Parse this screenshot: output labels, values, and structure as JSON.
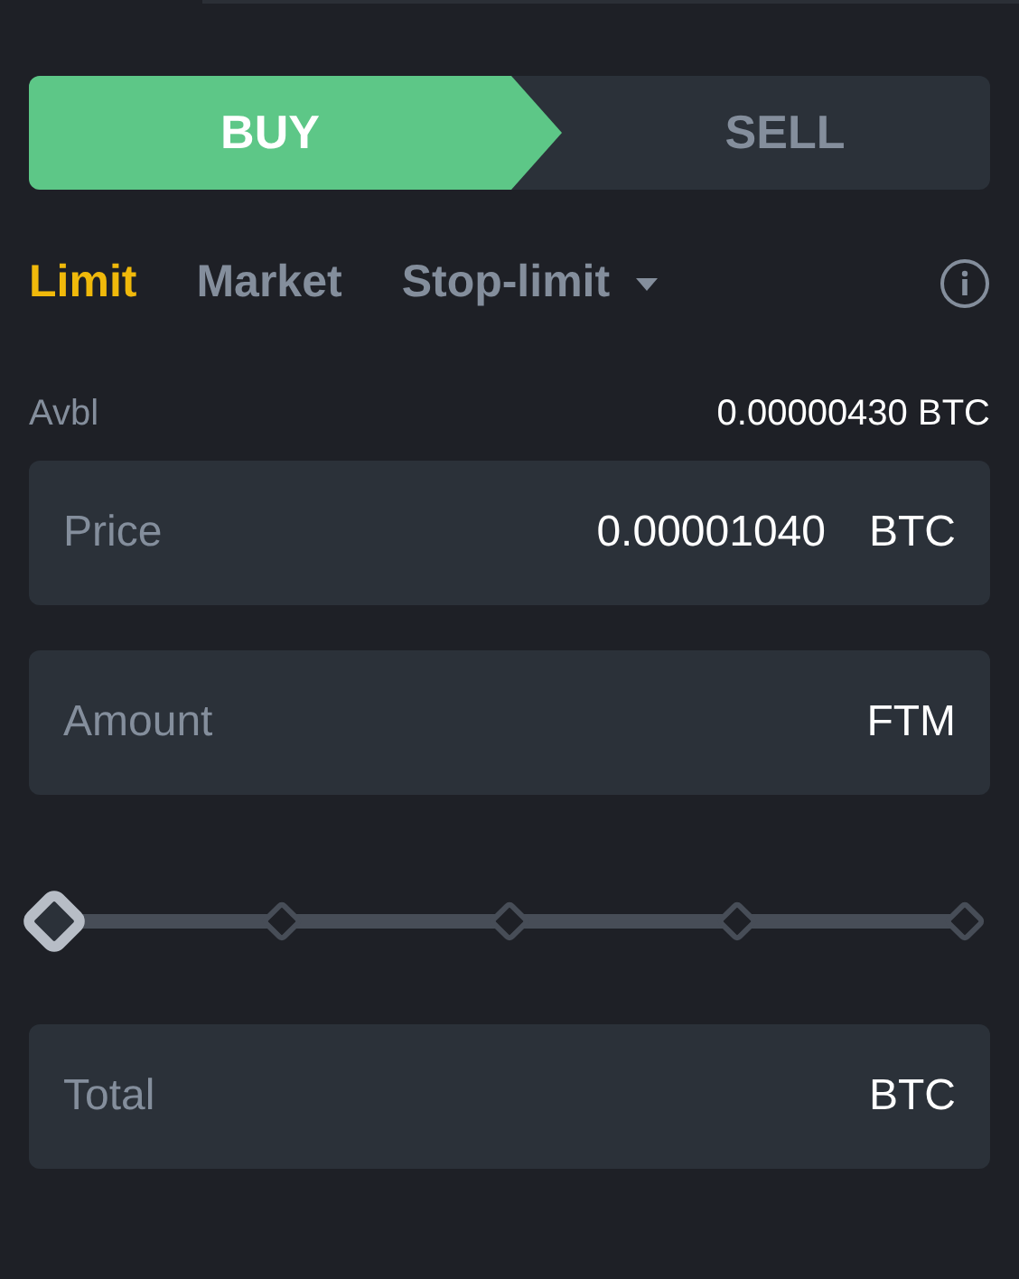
{
  "sides": [
    {
      "label": "BUY",
      "selected": true
    },
    {
      "label": "SELL",
      "selected": false
    }
  ],
  "order_types": [
    {
      "label": "Limit",
      "selected": true,
      "kind": "plain"
    },
    {
      "label": "Market",
      "selected": false,
      "kind": "plain"
    },
    {
      "label": "Stop-limit",
      "selected": false,
      "kind": "dropdown"
    }
  ],
  "available": {
    "label": "Avbl",
    "value": "0.00000430 BTC"
  },
  "fields": [
    {
      "placeholder": "Price",
      "value": "0.00001040",
      "unit": "BTC"
    },
    {
      "placeholder": "Amount",
      "unit": "FTM"
    }
  ],
  "slider": {
    "level": 0
  },
  "total": {
    "placeholder": "Total",
    "unit": "BTC"
  }
}
